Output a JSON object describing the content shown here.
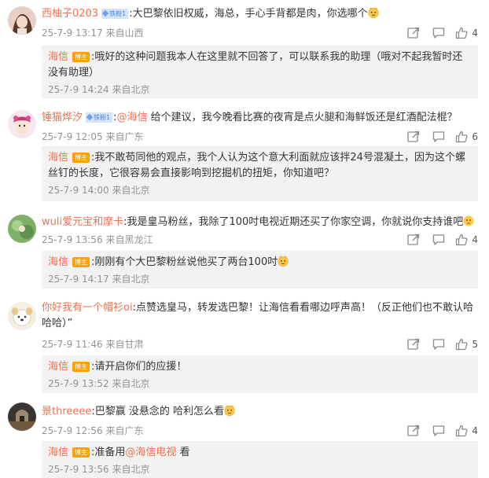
{
  "host_badge": "博主",
  "fan_badge": "铁粉1",
  "comments": [
    {
      "user": "西柚子0203",
      "text": ":大巴黎依旧权威，海总，手心手背都是肉，你选哪个",
      "time": "25-7-9 13:17",
      "location": "来自山西",
      "likes": "4",
      "reply": {
        "user": "海信",
        "text": ":哦好的这种问题我本人在这里就不回答了，可以联系我的助理（哦对不起我暂时还没有助理）",
        "time": "25-7-9 14:24",
        "location": "来自北京"
      }
    },
    {
      "user": "锤猫烨汐",
      "text_pre": ":",
      "mention": "@海信",
      "text": " 给个建议，我今晚看比赛的夜宵是点火腿和海鲜饭还是红酒配法棍？",
      "time": "25-7-9 12:05",
      "location": "来自广东",
      "likes": "6",
      "reply": {
        "user": "海信",
        "text": ":我不敢苟同他的观点，我个人认为这个意大利面就应该拌24号混凝土，因为这个螺丝钉的长度，它很容易会直接影响到挖掘机的扭矩，你知道吧？",
        "time": "25-7-9 14:00",
        "location": "来自北京"
      }
    },
    {
      "user": "wuli爱元宝和摩卡",
      "text": ":我是皇马粉丝，我除了100吋电视近期还买了你家空调，你就说你支持谁吧",
      "time": "25-7-9 13:56",
      "location": "来自黑龙江",
      "likes": "4",
      "reply": {
        "user": "海信",
        "text": ":刚刚有个大巴黎粉丝说他买了两台100吋",
        "time": "25-7-9 14:17",
        "location": "来自北京"
      }
    },
    {
      "user": "你好我有一个帽衫oi",
      "text": ":点赞选皇马，转发选巴黎！让海信看看哪边呼声高！（反正他们也不敢认哈哈哈）”",
      "time": "25-7-9 11:46",
      "location": "来自甘肃",
      "likes": "5",
      "reply": {
        "user": "海信",
        "text": ":请开启你们的应援！",
        "time": "25-7-9 13:52",
        "location": "来自北京"
      }
    },
    {
      "user": "景threeee",
      "text": ":巴黎赢 没悬念的 哈利怎么看",
      "time": "25-7-9 12:56",
      "location": "来自广东",
      "likes": "4",
      "reply": {
        "user": "海信",
        "text_pre": ":准备用",
        "mention": "@海信电视",
        "text": " 看",
        "time": "25-7-9 13:56",
        "location": "来自北京"
      }
    }
  ]
}
